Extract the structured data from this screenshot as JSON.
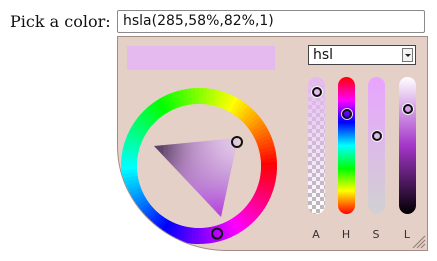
{
  "field": {
    "label": "Pick a color:",
    "value": "hsla(285,58%,82%,1)"
  },
  "color": {
    "hue": 285,
    "saturation": 58,
    "lightness": 82,
    "alpha": 1,
    "preview": "#e4baef"
  },
  "mode_select": {
    "selected": "hsl"
  },
  "sliders": [
    {
      "key": "alpha",
      "caption": "A",
      "level": 0.06
    },
    {
      "key": "hue",
      "caption": "H",
      "level": 0.24
    },
    {
      "key": "saturation",
      "caption": "S",
      "level": 0.42
    },
    {
      "key": "lightness",
      "caption": "L",
      "level": 0.2
    }
  ],
  "colors": {
    "panel_background": "#e5d0c7",
    "panel_border": "#a38c85"
  }
}
